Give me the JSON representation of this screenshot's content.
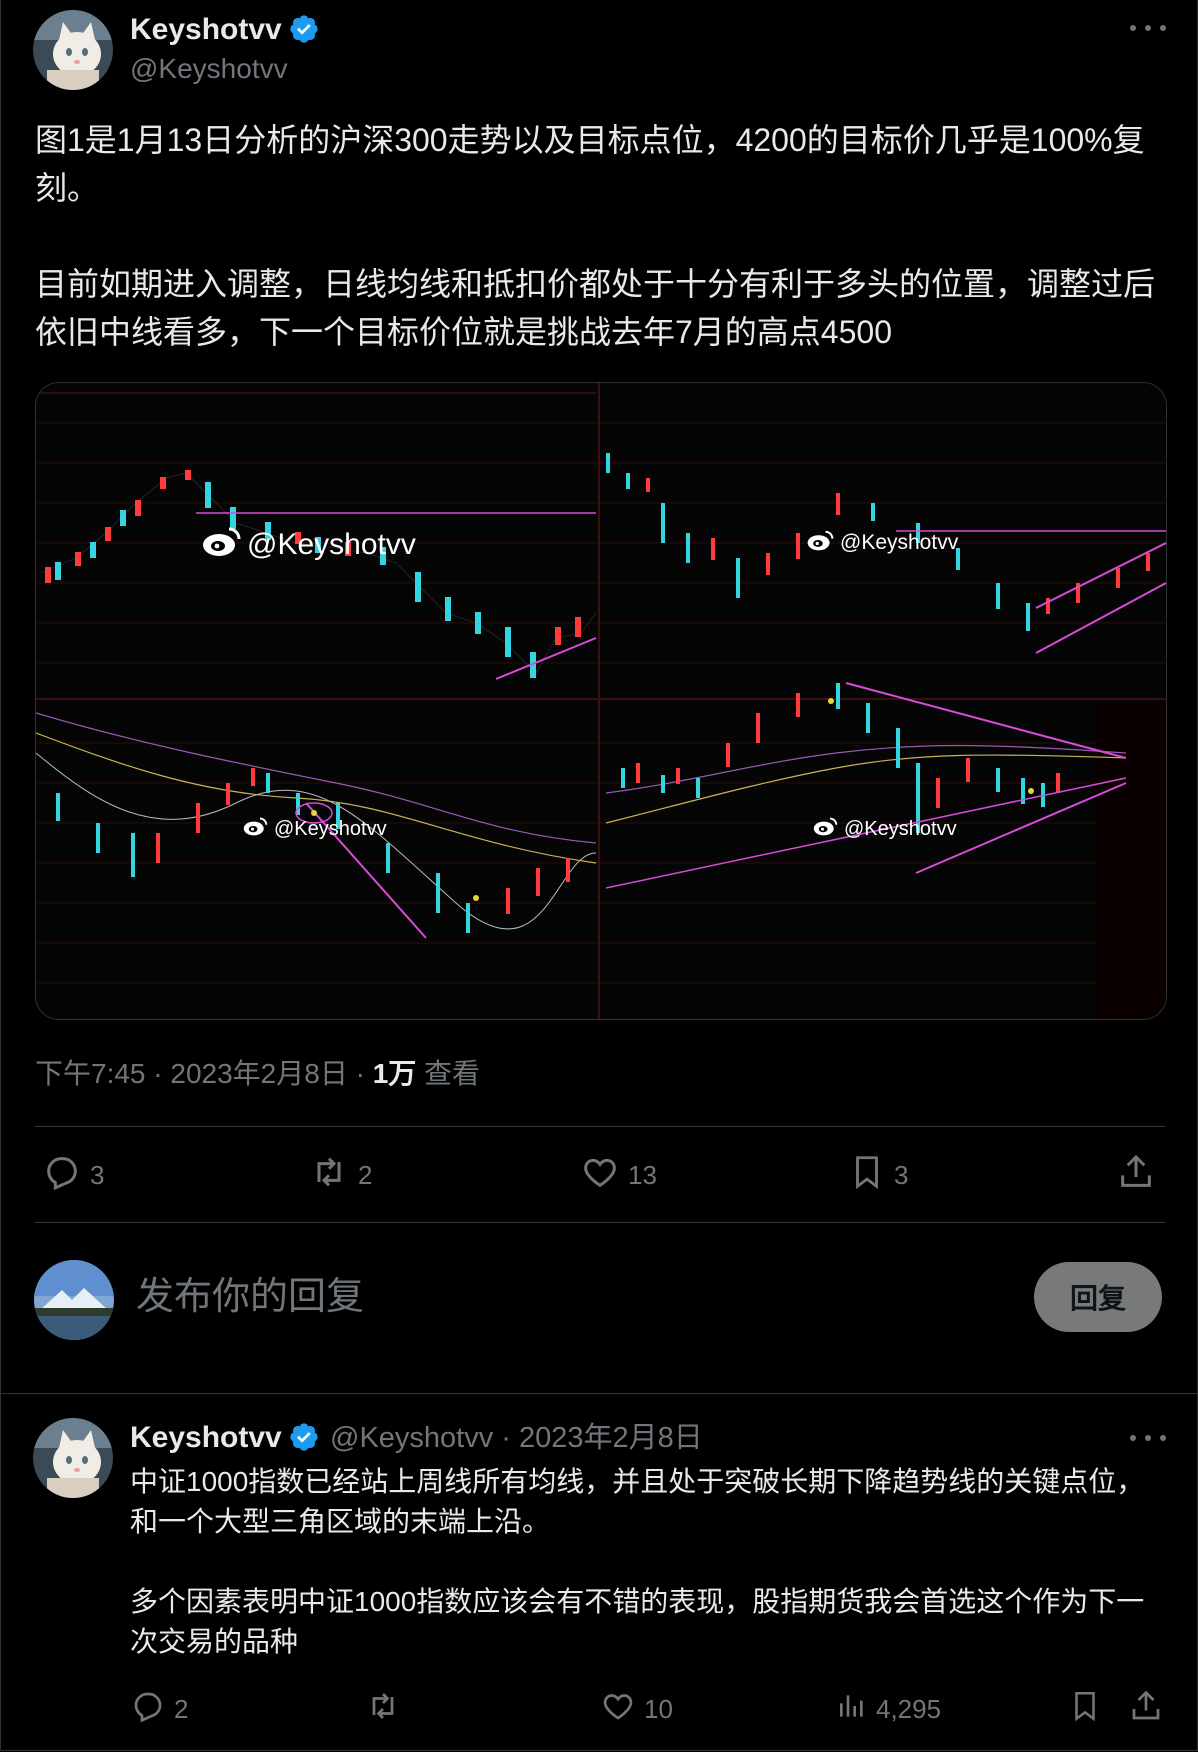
{
  "main_tweet": {
    "author_name": "Keyshotvv",
    "author_handle": "@Keyshotvv",
    "text": "图1是1月13日分析的沪深300走势以及目标点位，4200的目标价几乎是100%复刻。\n\n目前如期进入调整，日线均线和抵扣价都处于十分有利于多头的位置，调整过后依旧中线看多，下一个目标价位就是挑战去年7月的高点4500",
    "image_watermark": "@Keyshotvv",
    "meta_time": "下午7:45 · 2023年2月8日 · ",
    "meta_views": "1万",
    "meta_views_label": " 查看",
    "actions": {
      "replies": "3",
      "retweets": "2",
      "likes": "13",
      "bookmarks": "3"
    }
  },
  "composer": {
    "placeholder": "发布你的回复",
    "button_label": "回复"
  },
  "reply_tweet": {
    "author_name": "Keyshotvv",
    "meta": "@Keyshotvv · 2023年2月8日",
    "paragraph1": "中证1000指数已经站上周线所有均线，并且处于突破长期下降趋势线的关键点位，和一个大型三角区域的末端上沿。",
    "paragraph2": "多个因素表明中证1000指数应该会有不错的表现，股指期货我会首选这个作为下一次交易的品种",
    "actions": {
      "replies": "2",
      "likes": "10",
      "views": "4,295"
    }
  },
  "colors": {
    "background": "#000000",
    "text": "#e7e9ea",
    "muted": "#71767b",
    "verified": "#1d9bf0",
    "candle_up": "#ff3b3b",
    "candle_down": "#33d6e0",
    "trendline": "#d94bd9"
  }
}
